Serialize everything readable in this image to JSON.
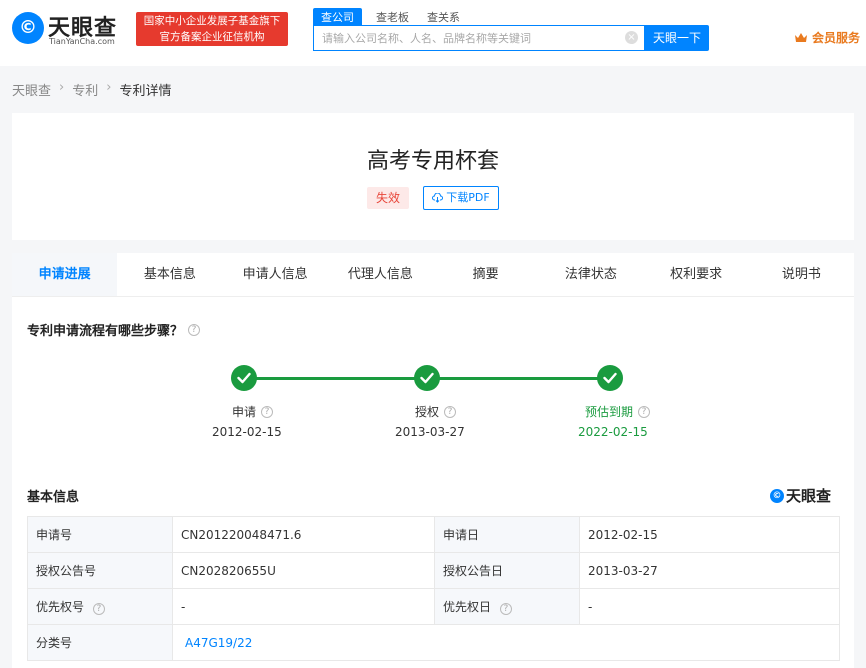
{
  "header": {
    "logo_text": "天眼查",
    "logo_sub": "TianYanCha.com",
    "banner_line1": "国家中小企业发展子基金旗下",
    "banner_line2": "官方备案企业征信机构",
    "search_tabs": [
      "查公司",
      "查老板",
      "查关系"
    ],
    "search_placeholder": "请输入公司名称、人名、品牌名称等关键词",
    "search_button": "天眼一下",
    "vip_label": "会员服务"
  },
  "breadcrumb": [
    "天眼查",
    "专利",
    "专利详情"
  ],
  "patent": {
    "title": "高考专用杯套",
    "status": "失效",
    "pdf_button": "下载PDF"
  },
  "tabs": [
    "申请进展",
    "基本信息",
    "申请人信息",
    "代理人信息",
    "摘要",
    "法律状态",
    "权利要求",
    "说明书"
  ],
  "progress": {
    "question": "专利申请流程有哪些步骤？",
    "steps": [
      {
        "label": "申请",
        "date": "2012-02-15"
      },
      {
        "label": "授权",
        "date": "2013-03-27"
      },
      {
        "label": "预估到期",
        "date": "2022-02-15"
      }
    ]
  },
  "basic_info": {
    "title": "基本信息",
    "brand": "天眼查",
    "rows": [
      {
        "k1": "申请号",
        "v1": "CN201220048471.6",
        "k2": "申请日",
        "v2": "2012-02-15"
      },
      {
        "k1": "授权公告号",
        "v1": "CN202820655U",
        "k2": "授权公告日",
        "v2": "2013-03-27"
      },
      {
        "k1": "优先权号",
        "v1": "-",
        "k2": "优先权日",
        "v2": "-"
      },
      {
        "k1": "分类号",
        "v1": "A47G19/22"
      }
    ]
  },
  "colors": {
    "primary": "#0084ff",
    "success": "#1a9b3f",
    "danger": "#e8473b",
    "vip": "#e97a1f"
  }
}
